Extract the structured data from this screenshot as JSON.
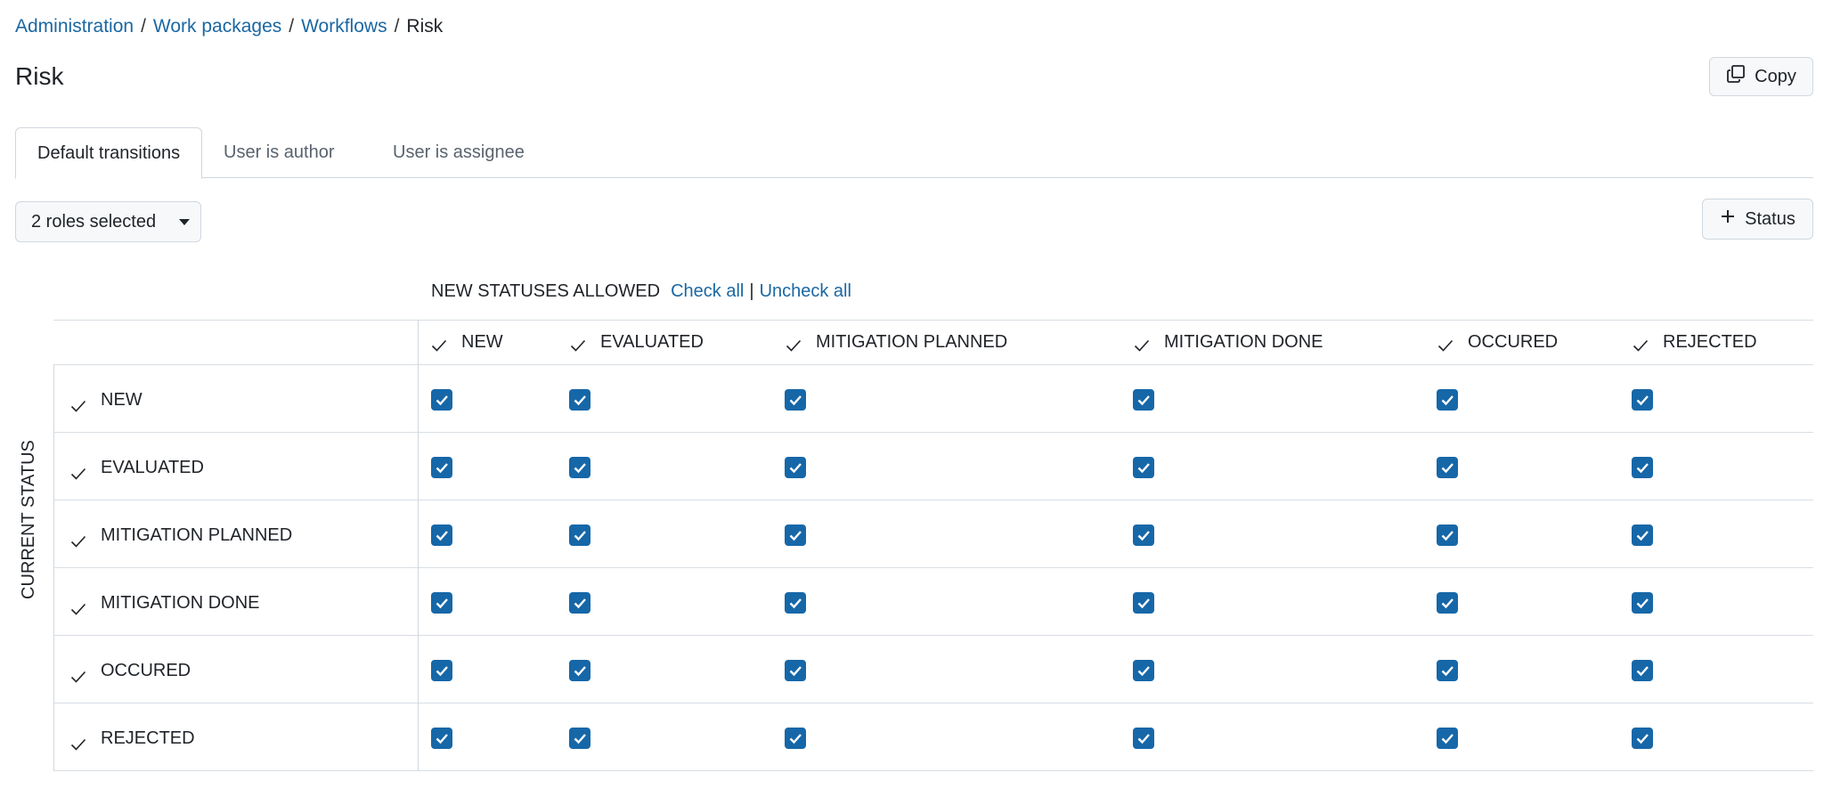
{
  "breadcrumb": {
    "items": [
      "Administration",
      "Work packages",
      "Workflows"
    ],
    "current": "Risk"
  },
  "page": {
    "title": "Risk"
  },
  "actions": {
    "copy_label": "Copy",
    "status_label": "Status"
  },
  "tabs": [
    {
      "label": "Default transitions",
      "active": true
    },
    {
      "label": "User is author",
      "active": false
    },
    {
      "label": "User is assignee",
      "active": false
    }
  ],
  "roles_select": {
    "value": "2 roles selected"
  },
  "matrix": {
    "header": "NEW STATUSES ALLOWED",
    "check_all": "Check all",
    "separator": "|",
    "uncheck_all": "Uncheck all",
    "row_axis_label": "CURRENT STATUS",
    "columns": [
      "NEW",
      "EVALUATED",
      "MITIGATION PLANNED",
      "MITIGATION DONE",
      "OCCURED",
      "REJECTED"
    ],
    "rows": [
      "NEW",
      "EVALUATED",
      "MITIGATION PLANNED",
      "MITIGATION DONE",
      "OCCURED",
      "REJECTED"
    ],
    "all_checked": true
  },
  "colors": {
    "accent": "#1667a8",
    "link": "#1a67a3",
    "border": "#d0d7de"
  },
  "icons": {
    "copy": "copy-icon",
    "plus": "plus-icon",
    "caret": "caret-down-icon",
    "check": "check-icon"
  }
}
